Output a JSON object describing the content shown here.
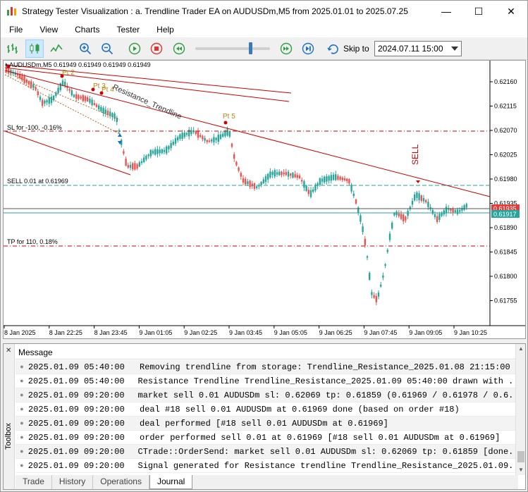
{
  "window": {
    "title": "Strategy Tester Visualization : a. Trendline Trader EA on AUDUSDm,M5 from 2025.01.01 to 2025.07.25",
    "minimize": "—",
    "maximize": "☐",
    "close": "✕"
  },
  "menu": [
    "File",
    "View",
    "Charts",
    "Tester",
    "Help"
  ],
  "toolbar": {
    "skip_label": "Skip to",
    "skip_date": "2024.07.11 15:00",
    "speed": 0.78,
    "icons": [
      "bar-chart-icon",
      "candlestick-icon",
      "line-chart-icon",
      "zoom-in-icon",
      "zoom-out-icon",
      "play-icon",
      "stop-icon",
      "rewind-icon",
      "fast-forward-icon",
      "skip-end-icon",
      "skip-to-icon"
    ]
  },
  "chart": {
    "symbol_header": "AUDUSDm,M5  0.61949 0.61949 0.61949 0.61949",
    "price_labels": [
      "0.62160",
      "0.62115",
      "0.62070",
      "0.62025",
      "0.61980",
      "0.61935",
      "0.61890",
      "0.61845",
      "0.61800",
      "0.61755"
    ],
    "current_bid": "0.61935",
    "current_ask": "0.61917",
    "time_labels": [
      "8 Jan 2025",
      "8 Jan 22:25",
      "8 Jan 23:45",
      "9 Jan 01:05",
      "9 Jan 02:25",
      "9 Jan 03:45",
      "9 Jan 05:05",
      "9 Jan 06:25",
      "9 Jan 07:45",
      "9 Jan 09:05",
      "9 Jan 10:25"
    ],
    "annotations": {
      "pt2": "Pt 2",
      "pt3": "Pt 3",
      "pt4": "Pt 4",
      "pt5": "Pt 5",
      "resistance": "Resistance_Trendline",
      "sl": "SL for -100, -0.16%",
      "sell_line": "SELL 0.01 at 0.61969",
      "tp": "TP for 110, 0.18%",
      "sell_signal": "SELL"
    },
    "colors": {
      "bull": "#26a69a",
      "bear": "#ef5350",
      "trendline": "#cc0000",
      "sl": "#cc0000",
      "entry": "#26a69a",
      "tp": "#cc0000",
      "bid_tag": "#e03c3c",
      "ask_tag": "#26a69a"
    }
  },
  "toolbox": {
    "side_label": "Toolbox",
    "column_header": "Message",
    "rows": [
      {
        "time": "2025.01.09 05:40:00",
        "text": "Removing trendline from storage: Trendline_Resistance_2025.01.08 21:15:00"
      },
      {
        "time": "2025.01.09 05:40:00",
        "text": "Resistance Trendline Trendline_Resistance_2025.01.09 05:40:00 drawn with ..."
      },
      {
        "time": "2025.01.09 09:20:00",
        "text": "market sell 0.01 AUDUSDm sl: 0.62069 tp: 0.61859 (0.61969 / 0.61978 / 0.6..."
      },
      {
        "time": "2025.01.09 09:20:00",
        "text": "deal #18 sell 0.01 AUDUSDm at 0.61969 done (based on order #18)"
      },
      {
        "time": "2025.01.09 09:20:00",
        "text": "deal performed [#18 sell 0.01 AUDUSDm at 0.61969]"
      },
      {
        "time": "2025.01.09 09:20:00",
        "text": "order performed sell 0.01 at 0.61969 [#18 sell 0.01 AUDUSDm at 0.61969]"
      },
      {
        "time": "2025.01.09 09:20:00",
        "text": "CTrade::OrderSend: market sell 0.01 AUDUSDm sl: 0.62069 tp: 0.61859 [done..."
      },
      {
        "time": "2025.01.09 09:20:00",
        "text": "Signal generated for Resistance trendline Trendline_Resistance_2025.01.09..."
      }
    ],
    "tabs": [
      "Trade",
      "History",
      "Operations",
      "Journal"
    ],
    "active_tab": "Journal"
  }
}
